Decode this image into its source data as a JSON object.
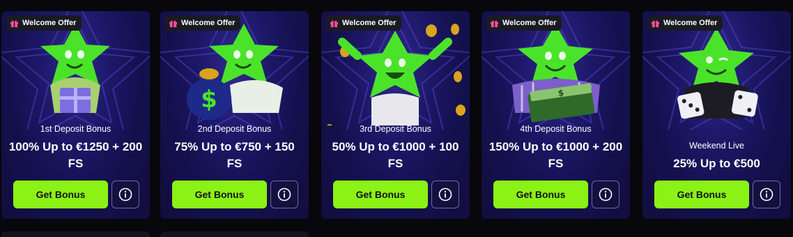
{
  "offers": [
    {
      "badge": "Welcome Offer",
      "subtitle": "1st Deposit Bonus",
      "title": "100% Up to €1250 + 200 FS",
      "cta": "Get Bonus",
      "mascot": "star-with-gift"
    },
    {
      "badge": "Welcome Offer",
      "subtitle": "2nd Deposit Bonus",
      "title": "75% Up to €750 + 150 FS",
      "cta": "Get Bonus",
      "mascot": "star-with-money-bag"
    },
    {
      "badge": "Welcome Offer",
      "subtitle": "3rd Deposit Bonus",
      "title": "50% Up to €1000 + 100 FS",
      "cta": "Get Bonus",
      "mascot": "star-with-coins"
    },
    {
      "badge": "Welcome Offer",
      "subtitle": "4th Deposit Bonus",
      "title": "150% Up to €1000 + 200 FS",
      "cta": "Get Bonus",
      "mascot": "star-with-cash-stack"
    },
    {
      "badge": "Welcome Offer",
      "subtitle": "Weekend Live",
      "title": "25% Up to €500",
      "cta": "Get Bonus",
      "mascot": "star-with-dice"
    }
  ],
  "colors": {
    "accent": "#8cf215",
    "card_bg": "#1c1766",
    "page_bg": "#07070c",
    "gift_icon": "#ff4fa0",
    "mascot_green": "#4be32a"
  },
  "icons": {
    "badge": "gift-icon",
    "info": "info-icon"
  }
}
